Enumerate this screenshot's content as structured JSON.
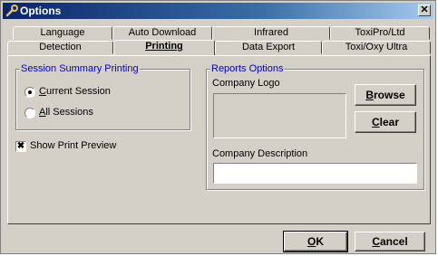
{
  "window": {
    "title": "Options",
    "close_glyph": "✕"
  },
  "tabs": {
    "row_back": [
      "Language",
      "Auto Download",
      "Infrared",
      "ToxiPro/Ltd"
    ],
    "row_front": [
      "Detection",
      "Printing",
      "Data Export",
      "Toxi/Oxy Ultra"
    ],
    "active": "Printing"
  },
  "session_group": {
    "legend": "Session Summary Printing",
    "options": [
      {
        "label": "Current Session",
        "accel": "C",
        "rest": "urrent Session",
        "checked": true
      },
      {
        "label": "All Sessions",
        "accel": "A",
        "rest": "ll Sessions",
        "checked": false
      }
    ]
  },
  "preview": {
    "label": "Show Print Preview",
    "checked": true,
    "mark": "✖"
  },
  "reports_group": {
    "legend": "Reports Options",
    "logo_label": "Company Logo",
    "browse": {
      "accel": "B",
      "rest": "rowse"
    },
    "clear": {
      "accel": "C",
      "rest": "lear"
    },
    "description_label": "Company Description",
    "description_value": ""
  },
  "footer": {
    "ok": {
      "accel": "O",
      "rest": "K"
    },
    "cancel": {
      "accel": "C",
      "rest": "ancel"
    }
  },
  "icons": {
    "title_icon": "wrench-icon"
  },
  "colors": {
    "titlebar_start": "#0a246a",
    "legend_text": "#0000c0",
    "face": "#d4d0c8"
  }
}
